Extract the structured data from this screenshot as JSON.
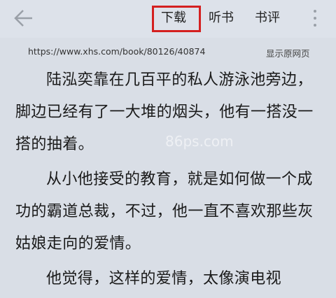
{
  "toolbar": {
    "back_icon": "back-arrow-icon",
    "download_label": "下载",
    "listen_label": "听书",
    "review_label": "书评",
    "more_icon": "more-vertical-icon",
    "highlight_color": "#d42020"
  },
  "url_bar": {
    "url": "https://www.xhs.com/book/80126/40874",
    "show_original": "显示原网页"
  },
  "article": {
    "paragraphs": [
      "陆泓奕靠在几百平的私人游泳池旁边，脚边已经有了一大堆的烟头，他有一搭没一搭的抽着。",
      "从小他接受的教育，就是如何做一个成功的霸道总裁，不过，他一直不喜欢那些灰姑娘走向的爱情。",
      "他觉得，这样的爱情，太像演电视"
    ]
  },
  "watermark": "86ps.com"
}
